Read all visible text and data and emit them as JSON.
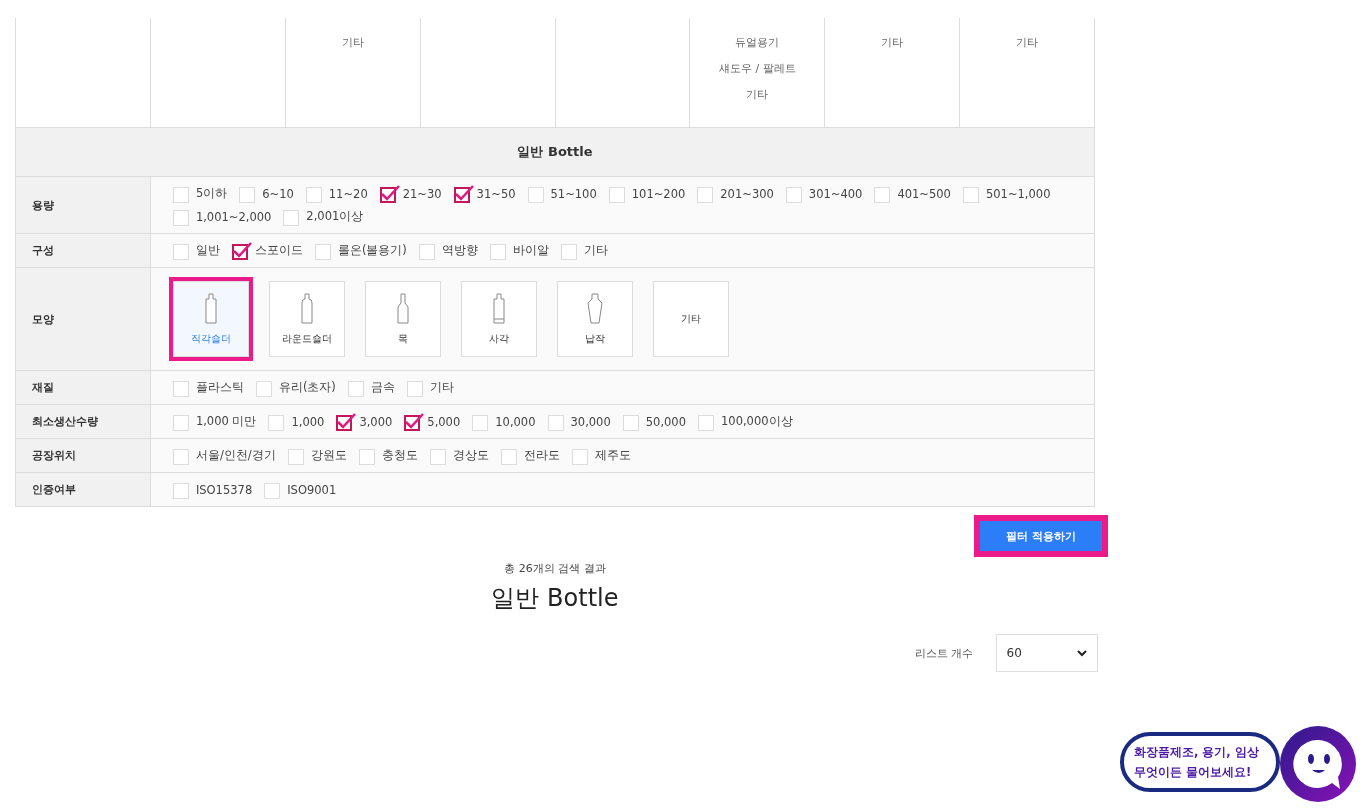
{
  "top_row": [
    {
      "kind": "blank"
    },
    {
      "kind": "blank"
    },
    {
      "kind": "list",
      "items": [
        "기타"
      ]
    },
    {
      "kind": "blank"
    },
    {
      "kind": "blank"
    },
    {
      "kind": "list",
      "items": [
        "듀얼용기",
        "섀도우 / 팔레트",
        "기타"
      ]
    },
    {
      "kind": "list",
      "items": [
        "기타"
      ]
    },
    {
      "kind": "list",
      "items": [
        "기타"
      ]
    }
  ],
  "section_title": "일반 Bottle",
  "filters": [
    {
      "label": "용량",
      "kind": "checks",
      "options": [
        {
          "label": "5이하",
          "checked": false
        },
        {
          "label": "6~10",
          "checked": false
        },
        {
          "label": "11~20",
          "checked": false
        },
        {
          "label": "21~30",
          "checked": true
        },
        {
          "label": "31~50",
          "checked": true
        },
        {
          "label": "51~100",
          "checked": false
        },
        {
          "label": "101~200",
          "checked": false
        },
        {
          "label": "201~300",
          "checked": false
        },
        {
          "label": "301~400",
          "checked": false
        },
        {
          "label": "401~500",
          "checked": false
        },
        {
          "label": "501~1,000",
          "checked": false
        },
        {
          "label": "1,001~2,000",
          "checked": false
        },
        {
          "label": "2,001이상",
          "checked": false
        }
      ]
    },
    {
      "label": "구성",
      "kind": "checks",
      "options": [
        {
          "label": "일반",
          "checked": false
        },
        {
          "label": "스포이드",
          "checked": true
        },
        {
          "label": "롤온(볼용기)",
          "checked": false
        },
        {
          "label": "역방향",
          "checked": false
        },
        {
          "label": "바이알",
          "checked": false
        },
        {
          "label": "기타",
          "checked": false
        }
      ]
    },
    {
      "label": "모양",
      "kind": "shapes",
      "options": [
        {
          "label": "직각숄더",
          "kind": "rect-shoulder",
          "selected": true
        },
        {
          "label": "라운드숄더",
          "kind": "round-shoulder",
          "selected": false
        },
        {
          "label": "목",
          "kind": "neck",
          "selected": false
        },
        {
          "label": "사각",
          "kind": "square",
          "selected": false
        },
        {
          "label": "납작",
          "kind": "flat",
          "selected": false
        },
        {
          "label": "기타",
          "kind": "other",
          "selected": false
        }
      ]
    },
    {
      "label": "재질",
      "kind": "checks",
      "options": [
        {
          "label": "플라스틱",
          "checked": false
        },
        {
          "label": "유리(초자)",
          "checked": false
        },
        {
          "label": "금속",
          "checked": false
        },
        {
          "label": "기타",
          "checked": false
        }
      ]
    },
    {
      "label": "최소생산수량",
      "kind": "checks",
      "options": [
        {
          "label": "1,000 미만",
          "checked": false
        },
        {
          "label": "1,000",
          "checked": false
        },
        {
          "label": "3,000",
          "checked": true
        },
        {
          "label": "5,000",
          "checked": true
        },
        {
          "label": "10,000",
          "checked": false
        },
        {
          "label": "30,000",
          "checked": false
        },
        {
          "label": "50,000",
          "checked": false
        },
        {
          "label": "100,000이상",
          "checked": false
        }
      ]
    },
    {
      "label": "공장위치",
      "kind": "checks",
      "options": [
        {
          "label": "서울/인천/경기",
          "checked": false
        },
        {
          "label": "강원도",
          "checked": false
        },
        {
          "label": "충청도",
          "checked": false
        },
        {
          "label": "경상도",
          "checked": false
        },
        {
          "label": "전라도",
          "checked": false
        },
        {
          "label": "제주도",
          "checked": false
        }
      ]
    },
    {
      "label": "인증여부",
      "kind": "checks",
      "options": [
        {
          "label": "ISO15378",
          "checked": false
        },
        {
          "label": "ISO9001",
          "checked": false
        }
      ]
    }
  ],
  "apply_button": "필터 적용하기",
  "result_count": "총 26개의 검색 결과",
  "result_title": "일반 Bottle",
  "list_count": {
    "label": "리스트 개수",
    "value": "60"
  },
  "chat": {
    "lines": [
      "화장품제조, 용기, 임상",
      "무엇이든 물어보세요!"
    ]
  }
}
